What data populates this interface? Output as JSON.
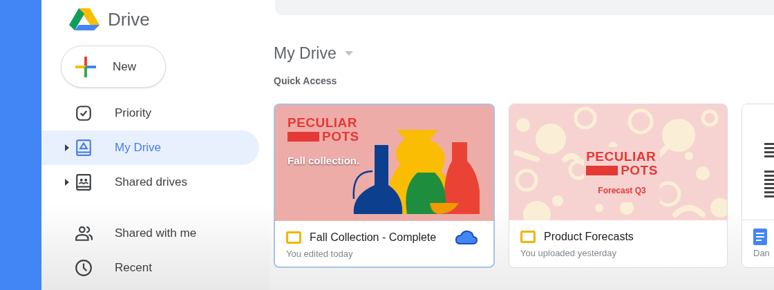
{
  "header": {
    "app_name": "Drive"
  },
  "sidebar": {
    "new_button": {
      "label": "New"
    },
    "groups": [
      [
        {
          "kind": "priority",
          "label": "Priority",
          "selected": false,
          "expandable": false
        },
        {
          "kind": "mydrive",
          "label": "My Drive",
          "selected": true,
          "expandable": true
        },
        {
          "kind": "shareddrives",
          "label": "Shared drives",
          "selected": false,
          "expandable": true
        }
      ],
      [
        {
          "kind": "sharedwithme",
          "label": "Shared with me",
          "selected": false,
          "expandable": false
        },
        {
          "kind": "recent",
          "label": "Recent",
          "selected": false,
          "expandable": false
        }
      ]
    ]
  },
  "main": {
    "title": "My Drive",
    "section": "Quick Access",
    "cards": [
      {
        "thumbnail": {
          "kind": "vases",
          "texts": [
            "PECULIAR",
            "POTS",
            "Fall collection."
          ]
        },
        "kind": "slides",
        "name": "Fall Collection - Complete",
        "detail": "You edited today",
        "selected": true,
        "cloud": true
      },
      {
        "thumbnail": {
          "kind": "pattern",
          "texts": [
            "PECULIAR",
            "POTS",
            "Forecast Q3"
          ]
        },
        "kind": "slides",
        "name": "Product Forecasts",
        "detail": "You uploaded yesterday",
        "selected": false,
        "cloud": false
      },
      {
        "thumbnail": {
          "kind": "document"
        },
        "kind": "docs",
        "detail": "Dan",
        "selected": false,
        "cloud": false
      }
    ]
  }
}
